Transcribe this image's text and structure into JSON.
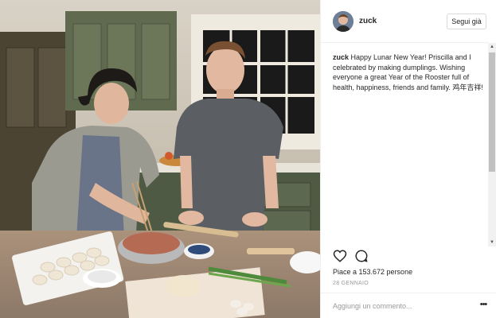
{
  "post": {
    "username": "zuck",
    "follow_label": "Segui già",
    "caption_user": "zuck",
    "caption_text": " Happy Lunar New Year! Priscilla and I celebrated by making dumplings. Wishing everyone a great Year of the Rooster full of health, happiness, friends and family. 鸡年吉祥!",
    "likes_text": "Piace a 153.672 persone",
    "date_text": "28 GENNAIO",
    "comment_placeholder": "Aggiungi un commento..."
  },
  "icons": {
    "like": "heart-icon",
    "comment": "comment-icon",
    "more": "more-options-icon"
  }
}
